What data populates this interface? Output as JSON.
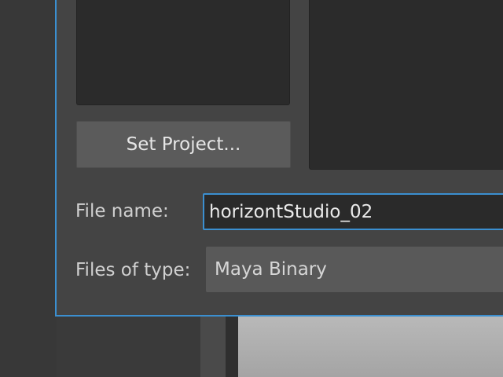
{
  "dialog": {
    "set_project_label": "Set Project...",
    "file_name_label": "File name:",
    "file_name_value": "horizontStudio_02",
    "files_of_type_label": "Files of type:",
    "files_of_type_value": "Maya Binary"
  },
  "colors": {
    "accent": "#3b8fd0",
    "dialog_bg": "#444444",
    "panel_bg": "#2b2b2b"
  }
}
